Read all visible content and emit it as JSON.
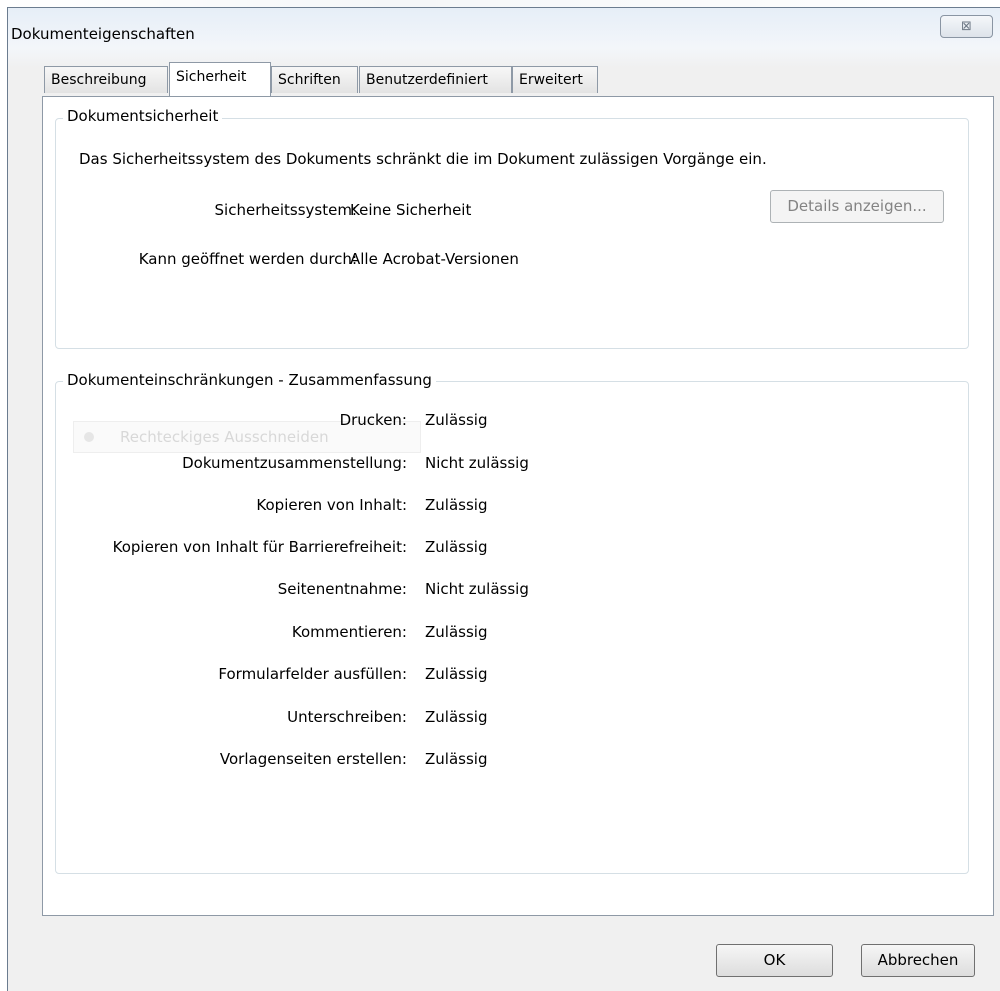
{
  "window": {
    "title": "Dokumenteigenschaften",
    "close_symbol": "⊠"
  },
  "tabs": [
    {
      "label": "Beschreibung",
      "active": false
    },
    {
      "label": "Sicherheit",
      "active": true
    },
    {
      "label": "Schriften",
      "active": false
    },
    {
      "label": "Benutzerdefiniert",
      "active": false
    },
    {
      "label": "Erweitert",
      "active": false
    }
  ],
  "security": {
    "group_title": "Dokumentsicherheit",
    "description": "Das Sicherheitssystem des Dokuments schränkt die im Dokument zulässigen Vorgänge ein.",
    "system_label": "Sicherheitssystem:",
    "system_value": "Keine Sicherheit",
    "opened_by_label": "Kann geöffnet werden durch:",
    "opened_by_value": "Alle Acrobat-Versionen",
    "details_button": "Details anzeigen..."
  },
  "restrictions": {
    "group_title": "Dokumenteinschränkungen - Zusammenfassung",
    "ghost_tooltip": "Rechteckiges Ausschneiden",
    "rows": [
      {
        "label": "Drucken:",
        "value": "Zulässig"
      },
      {
        "label": "Dokumentzusammenstellung:",
        "value": "Nicht zulässig"
      },
      {
        "label": "Kopieren von Inhalt:",
        "value": "Zulässig"
      },
      {
        "label": "Kopieren von Inhalt für Barrierefreiheit:",
        "value": "Zulässig"
      },
      {
        "label": "Seitenentnahme:",
        "value": "Nicht zulässig"
      },
      {
        "label": "Kommentieren:",
        "value": "Zulässig"
      },
      {
        "label": "Formularfelder ausfüllen:",
        "value": "Zulässig"
      },
      {
        "label": "Unterschreiben:",
        "value": "Zulässig"
      },
      {
        "label": "Vorlagenseiten erstellen:",
        "value": "Zulässig"
      }
    ]
  },
  "footer": {
    "ok_label": "OK",
    "cancel_label": "Abbrechen"
  }
}
